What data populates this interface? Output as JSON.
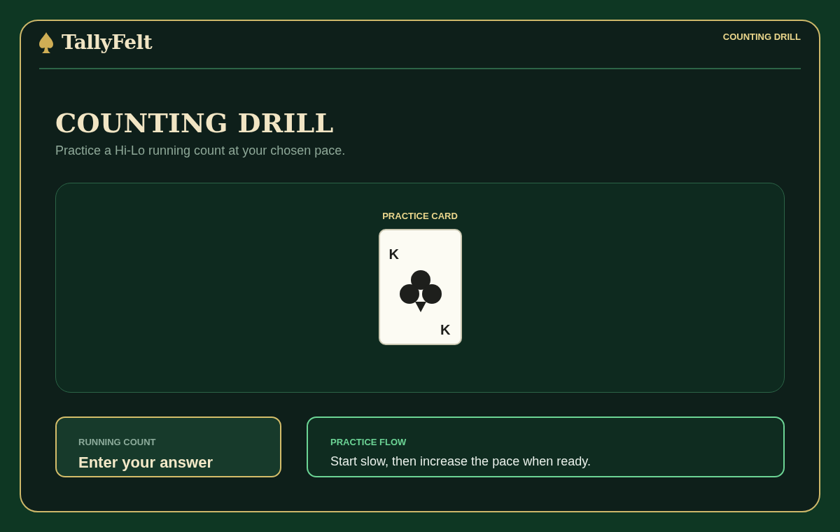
{
  "brand": {
    "name": "TallyFelt"
  },
  "nav_link": "COUNTING DRILL",
  "page": {
    "title": "COUNTING DRILL",
    "subtitle": "Practice a Hi-Lo running count at your chosen pace."
  },
  "card_stage": {
    "label": "PRACTICE CARD",
    "card": {
      "rank_top": "K",
      "rank_bottom": "K"
    }
  },
  "running_count": {
    "label": "RUNNING COUNT",
    "placeholder": "Enter your answer"
  },
  "practice_flow": {
    "label": "PRACTICE FLOW",
    "text": "Start slow, then increase the pace when ready."
  }
}
